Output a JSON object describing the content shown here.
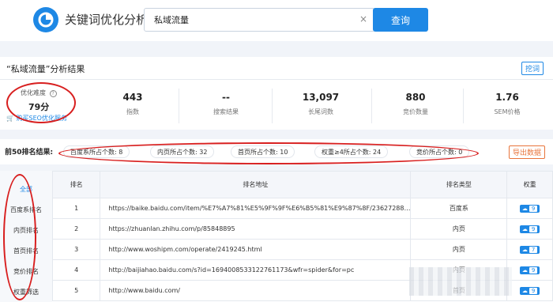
{
  "app": {
    "title": "关键词优化分析"
  },
  "search": {
    "value": "私域流量",
    "button": "查询",
    "clear": "×"
  },
  "summary": {
    "title": "“私域流量”分析结果",
    "keyword_button": "挖词",
    "difficulty_label": "优化难度",
    "difficulty_info": "?",
    "difficulty_value": "79分",
    "buy_link": "购买SEO优化服务",
    "stats": [
      {
        "value": "443",
        "label": "指数"
      },
      {
        "value": "--",
        "label": "搜索结果"
      },
      {
        "value": "13,097",
        "label": "长尾词数"
      },
      {
        "value": "880",
        "label": "竞价数量"
      },
      {
        "value": "1.76",
        "label": "SEM价格"
      }
    ]
  },
  "top50": {
    "title": "前50排名结果:",
    "chips": [
      "百度系所占个数: 8",
      "内页所占个数: 32",
      "首页所占个数: 10",
      "权重≥4所占个数: 24",
      "竞价所占个数: 0"
    ],
    "export": "导出数据"
  },
  "sidebar": {
    "items": [
      "全部",
      "百度系排名",
      "内页排名",
      "首页排名",
      "竞价排名",
      "权重筛选"
    ]
  },
  "table": {
    "headers": [
      "排名",
      "排名地址",
      "排名类型",
      "权重"
    ],
    "rows": [
      {
        "rank": "1",
        "url": "https://baike.baidu.com/item/%E7%A7%81%E5%9F%9F%E6%B5%81%E9%87%8F/23627288…",
        "type": "百度系",
        "weight": "9"
      },
      {
        "rank": "2",
        "url": "https://zhuanlan.zhihu.com/p/85848895",
        "type": "内页",
        "weight": "9"
      },
      {
        "rank": "3",
        "url": "http://www.woshipm.com/operate/2419245.html",
        "type": "内页",
        "weight": "7"
      },
      {
        "rank": "4",
        "url": "http://baijiahao.baidu.com/s?id=1694008533122761173&wfr=spider&for=pc",
        "type": "内页",
        "weight": "9"
      },
      {
        "rank": "5",
        "url": "http://www.baidu.com/",
        "type": "首页",
        "weight": "9"
      }
    ]
  },
  "colors": {
    "accent": "#1e88e5",
    "annotation": "#d81f1f",
    "export": "#e8743b"
  }
}
